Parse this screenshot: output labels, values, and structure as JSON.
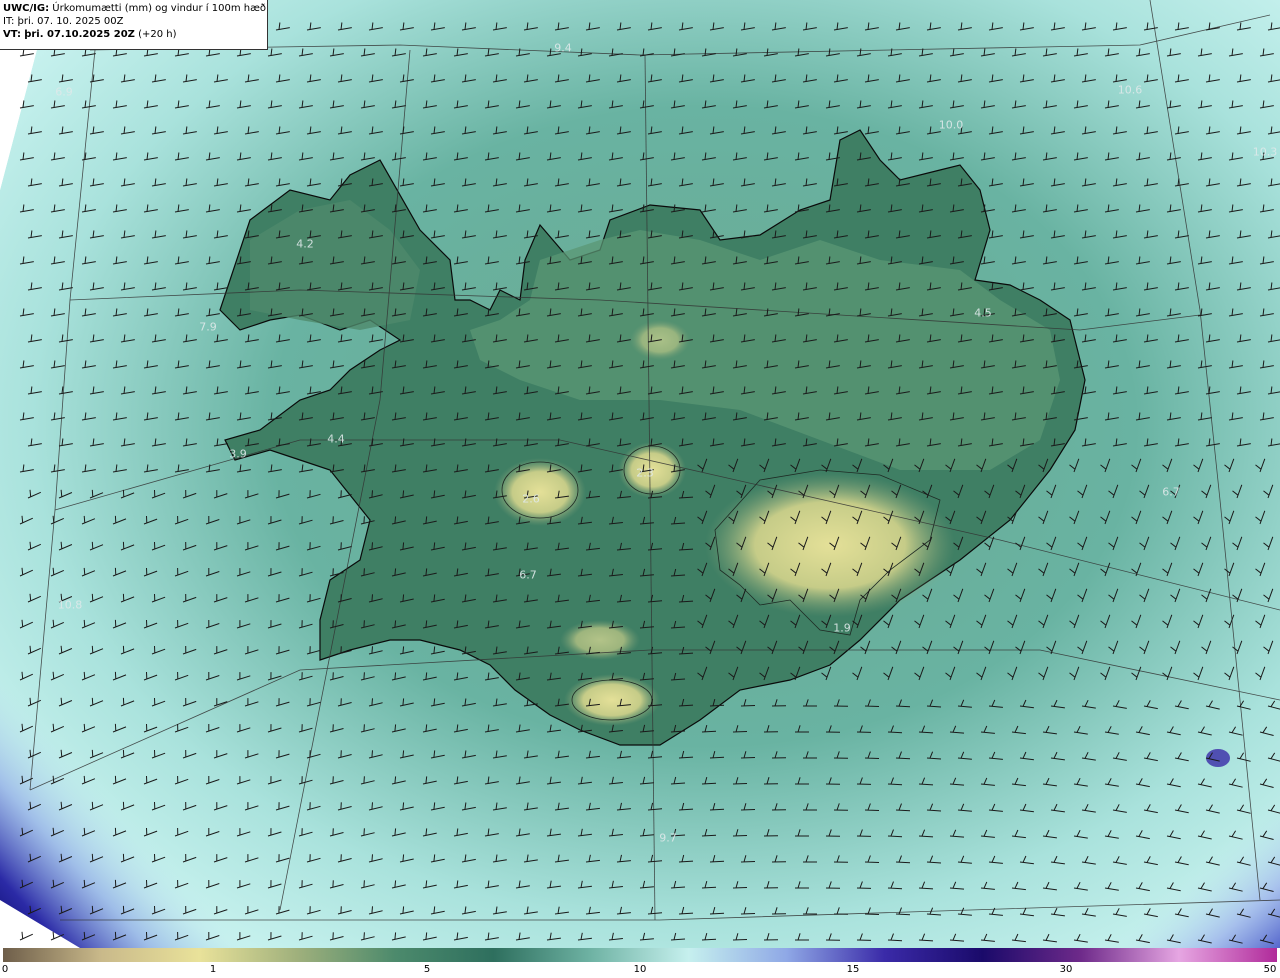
{
  "header": {
    "model": "UWC/IG:",
    "title": "Úrkomumætti (mm) og vindur í 100m hæð",
    "it_label": "IT:",
    "it_value": "þri. 07. 10. 2025 00Z",
    "vt_label": "VT:",
    "vt_value": "þri. 07.10.2025 20Z",
    "vt_offset": "(+20 h)"
  },
  "map_values": [
    {
      "id": "v1",
      "text": "6.9"
    },
    {
      "id": "v2",
      "text": "9.4"
    },
    {
      "id": "v3",
      "text": "10.6"
    },
    {
      "id": "v4",
      "text": "10.0"
    },
    {
      "id": "v5",
      "text": "10.3"
    },
    {
      "id": "v6",
      "text": "4.2"
    },
    {
      "id": "v7",
      "text": "7.9"
    },
    {
      "id": "v8",
      "text": "4.5"
    },
    {
      "id": "v9",
      "text": "4.4"
    },
    {
      "id": "v10",
      "text": "3.9"
    },
    {
      "id": "v11",
      "text": "2.3"
    },
    {
      "id": "v12",
      "text": "2.6"
    },
    {
      "id": "v13",
      "text": "6.7"
    },
    {
      "id": "v14",
      "text": "6.7"
    },
    {
      "id": "v15",
      "text": "10.8"
    },
    {
      "id": "v16",
      "text": "1.9"
    },
    {
      "id": "v17",
      "text": "9.7"
    }
  ],
  "legend": {
    "ticks": [
      "0",
      "1",
      "5",
      "10",
      "15",
      "30",
      "50"
    ],
    "colors": [
      "#6e5e4a",
      "#c9b98a",
      "#e9e29a",
      "#9fb07c",
      "#4c8a6c",
      "#2e6f5e",
      "#6fb3a4",
      "#c6f0ee",
      "#8fa8e6",
      "#3a2aa8",
      "#1a0a6a",
      "#6e2a8a",
      "#e6a6e2",
      "#b02a9a"
    ]
  },
  "colors": {
    "land_low": "#2f6f5a",
    "land_mid": "#5a9070",
    "land_dry": "#d8d890",
    "sea_light": "#bfeeea",
    "sea_mid": "#6ab8a8",
    "sea_deep": "#2a2aa0"
  }
}
